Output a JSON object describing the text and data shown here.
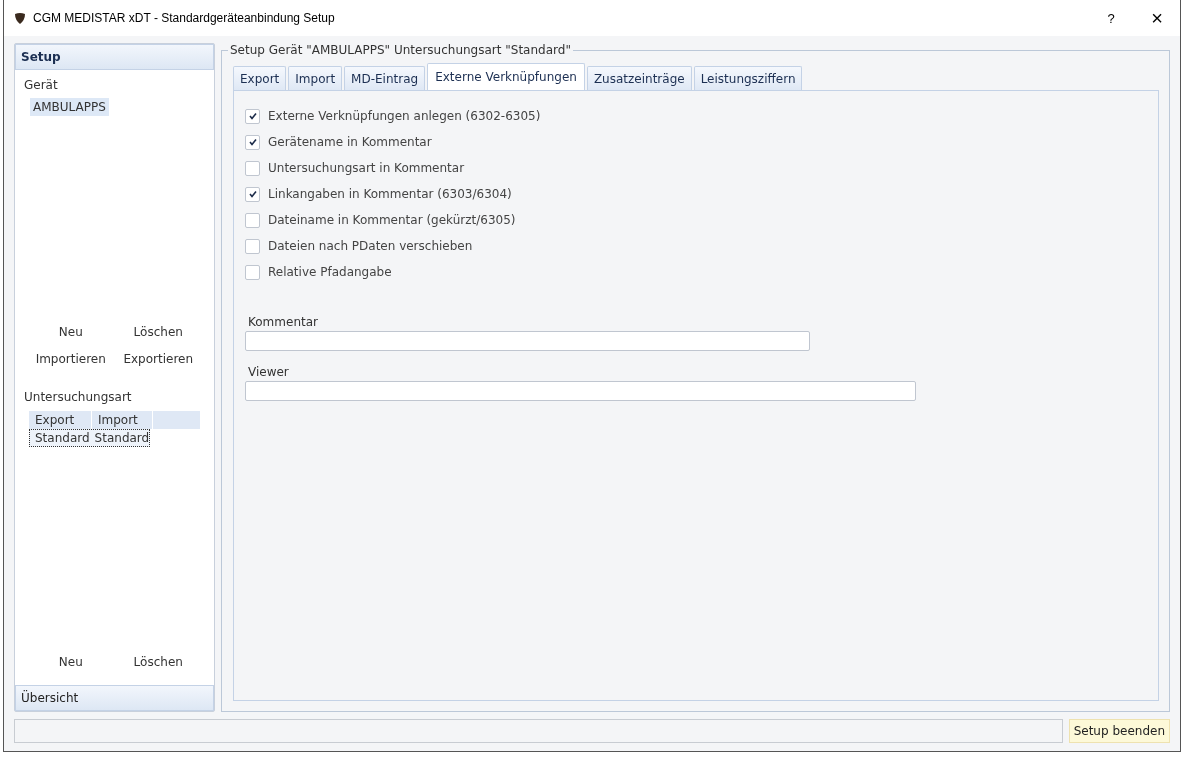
{
  "window": {
    "title": "CGM MEDISTAR xDT - Standardgeräteanbindung  Setup",
    "help": "?",
    "close": "×"
  },
  "sidebar": {
    "header": "Setup",
    "device_section": "Gerät",
    "devices": [
      {
        "label": "AMBULAPPS",
        "selected": true
      }
    ],
    "device_actions": [
      "Neu",
      "Löschen",
      "Importieren",
      "Exportieren"
    ],
    "exam_section": "Untersuchungsart",
    "exam_table": {
      "columns": [
        "Export",
        "Import"
      ],
      "rows": [
        {
          "cells": [
            "Standard",
            "Standard"
          ],
          "selected": true
        }
      ]
    },
    "exam_actions": [
      "Neu",
      "Löschen"
    ],
    "footer": "Übersicht"
  },
  "group": {
    "title": "Setup Gerät \"AMBULAPPS\" Untersuchungsart \"Standard\"",
    "tabs": [
      {
        "label": "Export",
        "selected": false
      },
      {
        "label": "Import",
        "selected": false
      },
      {
        "label": "MD-Eintrag",
        "selected": false
      },
      {
        "label": "Externe Verknüpfungen",
        "selected": true
      },
      {
        "label": "Zusatzeinträge",
        "selected": false
      },
      {
        "label": "Leistungsziffern",
        "selected": false
      }
    ],
    "options": [
      {
        "label": "Externe Verknüpfungen anlegen (6302-6305)",
        "checked": true
      },
      {
        "label": "Gerätename in Kommentar",
        "checked": true
      },
      {
        "label": "Untersuchungsart in Kommentar",
        "checked": false
      },
      {
        "label": "Linkangaben in Kommentar (6303/6304)",
        "checked": true
      },
      {
        "label": "Dateiname in Kommentar (gekürzt/6305)",
        "checked": false
      },
      {
        "label": "Dateien nach PDaten verschieben",
        "checked": false
      },
      {
        "label": "Relative Pfadangabe",
        "checked": false
      }
    ],
    "fields": [
      {
        "label": "Kommentar"
      },
      {
        "label": "Viewer"
      }
    ]
  },
  "footer": {
    "button": "Setup beenden"
  }
}
